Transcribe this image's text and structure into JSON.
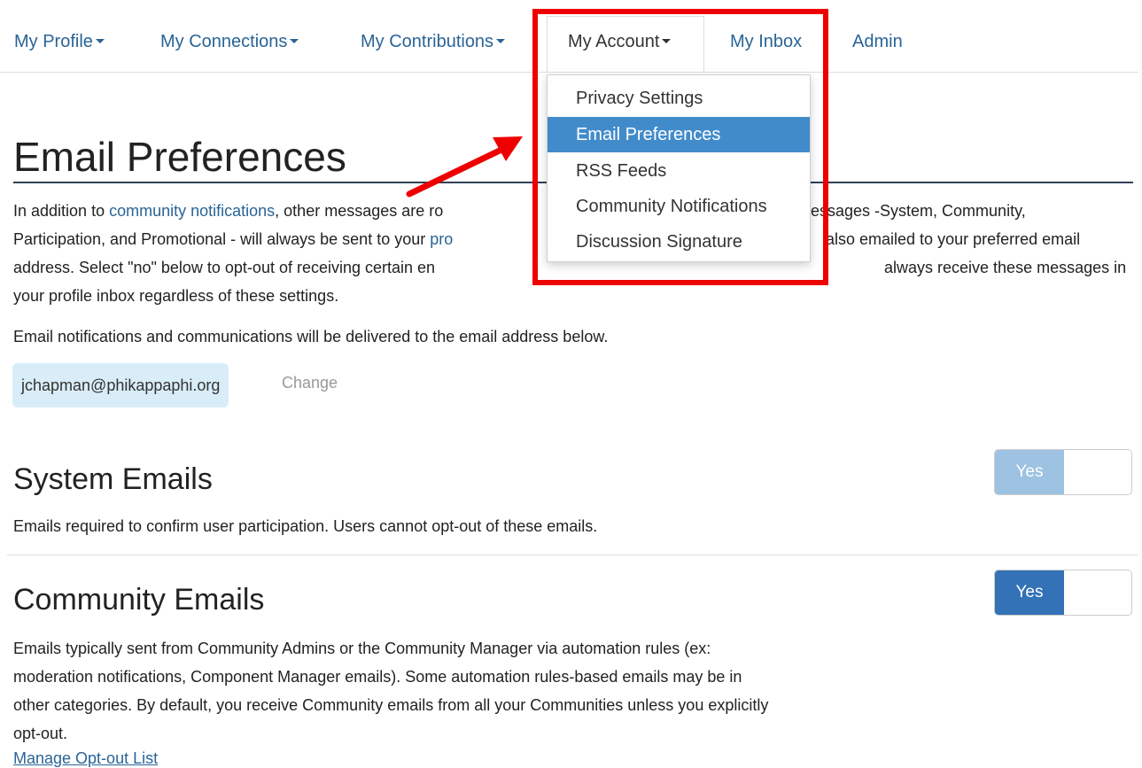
{
  "nav": {
    "items": [
      {
        "label": "My Profile",
        "caret": true
      },
      {
        "label": "My Connections",
        "caret": true
      },
      {
        "label": "My Contributions",
        "caret": true
      },
      {
        "label": "My Account",
        "caret": true,
        "active": true
      },
      {
        "label": "My Inbox",
        "caret": false
      },
      {
        "label": "Admin",
        "caret": false
      }
    ]
  },
  "dropdown": {
    "items": [
      {
        "label": "Privacy Settings"
      },
      {
        "label": "Email Preferences",
        "selected": true
      },
      {
        "label": "RSS Feeds"
      },
      {
        "label": "Community Notifications"
      },
      {
        "label": "Discussion Signature"
      }
    ]
  },
  "page": {
    "title": "Email Preferences",
    "intro": {
      "p1": "In addition to",
      "link": "community notifications",
      "p2": ", other messages are ro",
      "p3": "essages -System, Community,",
      "line2a": "Participation, and Promotional - will always be sent to your",
      "line2link": "pro",
      "line2b": "also emailed to your preferred email",
      "line3a": "address. Select \"no\" below to opt-out of receiving certain en",
      "line3b": "always receive these messages in",
      "line4": "your profile inbox regardless of these settings."
    },
    "delivery_note": "Email notifications and communications will be delivered to the email address below.",
    "email": "jchapman@phikappaphi.org",
    "change_label": "Change"
  },
  "sections": {
    "system": {
      "title": "System Emails",
      "description": "Emails required to confirm user participation. Users cannot opt-out of these emails.",
      "toggle_label": "Yes"
    },
    "community": {
      "title": "Community Emails",
      "description": [
        "Emails typically sent from Community Admins or the Community Manager via automation rules (ex:",
        "moderation notifications, Component Manager emails). Some automation rules-based emails may be in",
        "other categories. By default, you receive Community emails from all your Communities unless you explicitly",
        "opt-out."
      ],
      "toggle_label": "Yes",
      "manage_link": "Manage Opt-out List"
    }
  },
  "colors": {
    "link": "#2a6496",
    "selected_menu": "#428bca",
    "highlight_box": "#ee0000",
    "toggle_on": "#3372b6",
    "toggle_disabled": "#9ec2e2"
  }
}
